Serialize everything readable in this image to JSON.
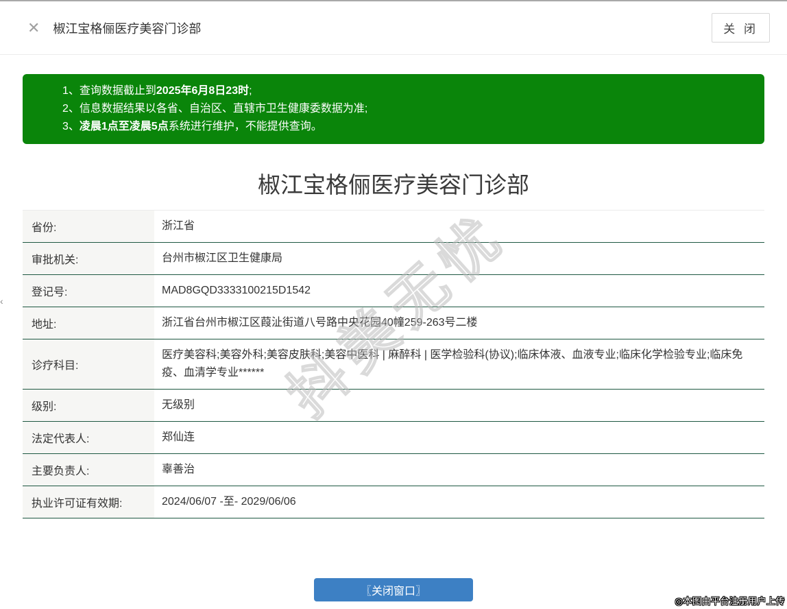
{
  "header": {
    "close_icon": "✕",
    "title": "椒江宝格俪医疗美容门诊部",
    "close_button": "关 闭"
  },
  "notice": {
    "lines": [
      {
        "pre": "1、查询数据截止到",
        "bold": "2025年6月8日23时",
        "post": ";"
      },
      {
        "pre": "2、信息数据结果以各省、自治区、直辖市卫生健康委数据为准;",
        "bold": "",
        "post": ""
      },
      {
        "pre": "3、",
        "bold": "凌晨1点至凌晨5点",
        "post": "系统进行维护，不能提供查询。"
      }
    ]
  },
  "detail": {
    "title": "椒江宝格俪医疗美容门诊部",
    "rows": [
      {
        "label": "省份:",
        "value": "浙江省"
      },
      {
        "label": "审批机关:",
        "value": "台州市椒江区卫生健康局"
      },
      {
        "label": "登记号:",
        "value": "MAD8GQD3333100215D1542"
      },
      {
        "label": "地址:",
        "value": "浙江省台州市椒江区葭沚街道八号路中央花园40幢259-263号二楼"
      },
      {
        "label": "诊疗科目:",
        "value": "医疗美容科;美容外科;美容皮肤科;美容中医科 | 麻醉科 | 医学检验科(协议);临床体液、血液专业;临床化学检验专业;临床免疫、血清学专业******"
      },
      {
        "label": "级别:",
        "value": "无级别"
      },
      {
        "label": "法定代表人:",
        "value": "郑仙连"
      },
      {
        "label": "主要负责人:",
        "value": "辜善治"
      },
      {
        "label": "执业许可证有效期:",
        "value": "2024/06/07 -至- 2029/06/06"
      }
    ]
  },
  "watermark": "抖美无忧",
  "footer": {
    "close_window_button": "〖关闭窗口〗"
  },
  "stamp": "◎本图由平台注册用户上传",
  "icons": {
    "left_edge_arrow": "‹"
  },
  "colors": {
    "notice_green": "#0a850a",
    "divider_green": "#1d5741",
    "button_blue": "#3d80c4",
    "label_cell_bg": "#f6f6f4"
  }
}
